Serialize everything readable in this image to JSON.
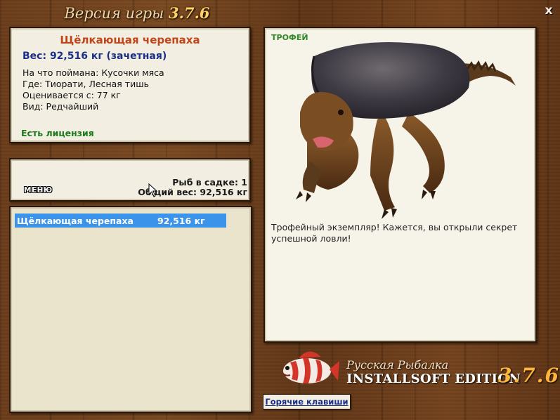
{
  "window": {
    "title_prefix": "Версия игры",
    "title_version": "3.7.6",
    "close_label": "x"
  },
  "info": {
    "fish_name": "Щёлкающая черепаха",
    "weight": "Вес: 92,516 кг (зачетная)",
    "caught_on": "На что поймана: Кусочки мяса",
    "location": "Где: Тиорати, Лесная тишь",
    "valued_from": "Оценивается с: 77 кг",
    "kind": "Вид: Редчайший",
    "license": "Есть лицензия"
  },
  "cage": {
    "menu_label": "МЕНЮ",
    "fish_count": "Рыб в садке: 1",
    "total_weight": "Общий вес: 92,516 кг"
  },
  "list": {
    "rows": [
      {
        "name": "Щёлкающая черепаха",
        "weight": "92,516 кг"
      }
    ]
  },
  "trophy": {
    "tag": "ТРОФЕЙ",
    "text": "Трофейный экземпляр! Кажется, вы открыли секрет успешной ловли!"
  },
  "logo": {
    "russian": "Русская Рыбалка",
    "edition": "INSTALLSOFT EDITION",
    "version": "3.7.6"
  },
  "hotkeys_label": "Горячие клавиши",
  "colors": {
    "fish_name": "#c0461a",
    "weight": "#1b2f8a",
    "license": "#1b7a1b",
    "trophy_tag": "#2f8a24",
    "list_selection": "#3b93ea",
    "panel_bg": "#f2efe2"
  }
}
